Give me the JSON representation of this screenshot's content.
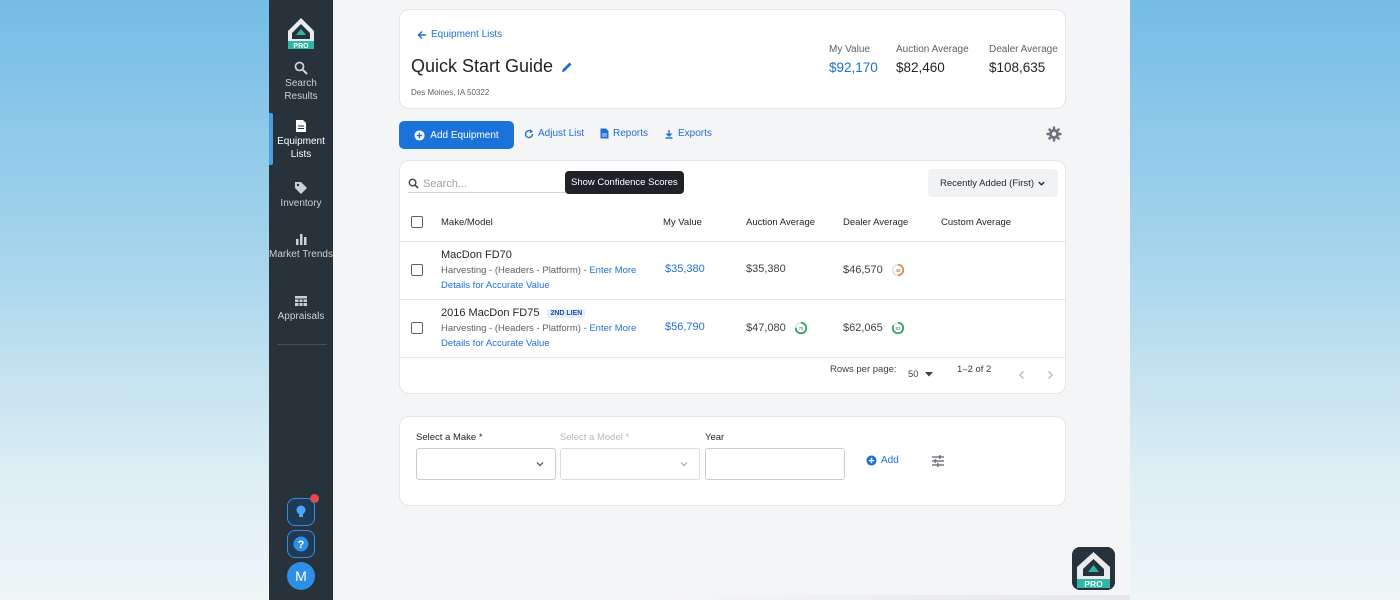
{
  "sidebar": {
    "logo_text": "PRO",
    "items": [
      {
        "label": "Search Results",
        "icon": "search-icon"
      },
      {
        "label": "Equipment Lists",
        "icon": "document-icon"
      },
      {
        "label": "Inventory",
        "icon": "tag-icon"
      },
      {
        "label": "Market Trends",
        "icon": "bar-chart-icon"
      },
      {
        "label": "Appraisals",
        "icon": "table-icon"
      }
    ],
    "avatar_initial": "M"
  },
  "header": {
    "back_label": "Equipment Lists",
    "title": "Quick Start Guide",
    "location": "Des Moines, IA 50322",
    "stats": [
      {
        "label": "My Value",
        "value": "$92,170"
      },
      {
        "label": "Auction Average",
        "value": "$82,460"
      },
      {
        "label": "Dealer Average",
        "value": "$108,635"
      }
    ]
  },
  "toolbar": {
    "add_equipment": "Add Equipment",
    "adjust_list": "Adjust List",
    "reports": "Reports",
    "exports": "Exports"
  },
  "table": {
    "search_placeholder": "Search...",
    "tooltip": "Show Confidence Scores",
    "sort_label": "Recently Added (First)",
    "columns": [
      "Make/Model",
      "My Value",
      "Auction Average",
      "Dealer Average",
      "Custom Average"
    ],
    "rows": [
      {
        "title": "MacDon FD70",
        "badge": "",
        "subtitle": "Harvesting - (Headers - Platform) - ",
        "link": "Enter More Details for Accurate Value",
        "my_value": "$35,380",
        "auction_avg": "$35,380",
        "auction_score": "",
        "dealer_avg": "$46,570",
        "dealer_score": "49"
      },
      {
        "title": "2016 MacDon FD75",
        "badge": "2ND LIEN",
        "subtitle": "Harvesting - (Headers - Platform) - ",
        "link": "Enter More Details for Accurate Value",
        "my_value": "$56,790",
        "auction_avg": "$47,080",
        "auction_score": "75",
        "dealer_avg": "$62,065",
        "dealer_score": "83"
      }
    ],
    "rows_per_page_label": "Rows per page:",
    "rows_per_page": "50",
    "range": "1–2 of 2"
  },
  "add_form": {
    "make_label": "Select a Make *",
    "model_label": "Select a Model *",
    "year_label": "Year",
    "add_label": "Add"
  },
  "colors": {
    "primary": "#1a73d9",
    "sidebar": "#27323a",
    "score_orange": "#e8893a",
    "score_green": "#2fa36b"
  }
}
